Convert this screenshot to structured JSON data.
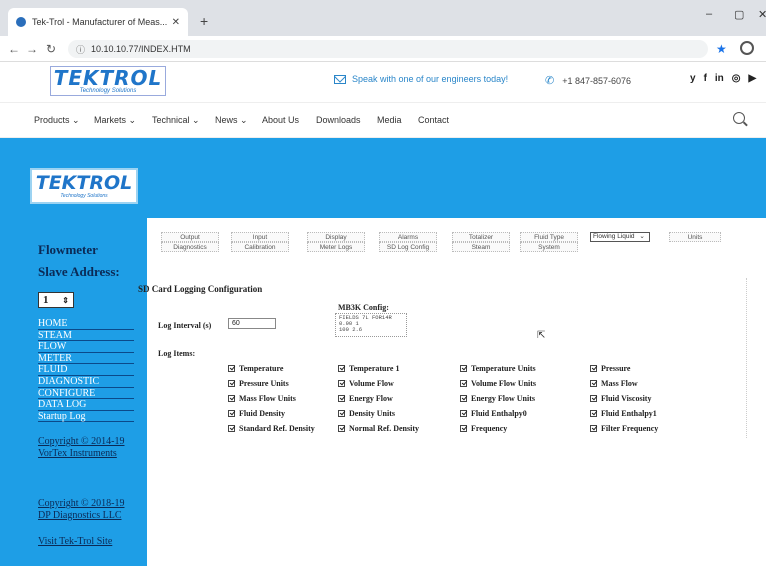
{
  "browser": {
    "tab_title": "Tek-Trol - Manufacturer of Meas...",
    "new_tab": "+",
    "url": "10.10.10.77/INDEX.HTM"
  },
  "site": {
    "logo_word": "TEKTROL",
    "logo_sub": "Technology Solutions",
    "speak_text": "Speak with one of our engineers today!",
    "phone": "+1 847-857-6076",
    "social": [
      "y",
      "f",
      "in",
      "◎",
      "▶"
    ],
    "nav": [
      "Products ⌄",
      "Markets ⌄",
      "Technical ⌄",
      "News ⌄",
      "About Us",
      "Downloads",
      "Media",
      "Contact"
    ]
  },
  "device": {
    "logo_word": "TEKTROL",
    "logo_sub": "Technology Solutions",
    "sidebar_title": "Flowmeter",
    "slave_label": "Slave Address:",
    "slave_value": "1",
    "menu": [
      "HOME",
      "STEAM",
      "FLOW",
      "METER",
      "FLUID",
      "DIAGNOSTIC",
      "CONFIGURE",
      "DATA LOG",
      "Startup Log"
    ],
    "copyright1": "Copyright © 2014-19",
    "copyright1_org": "VorTex Instruments",
    "copyright2": "Copyright © 2018-19",
    "copyright2_org": "DP Diagnostics LLC",
    "visit": "Visit Tek-Trol Site",
    "tabs_row1": [
      "Output",
      "Input",
      "Display",
      "Alarms",
      "Totalizer",
      "Fluid Type"
    ],
    "tabs_row2": [
      "Diagnostics",
      "Calibration",
      "Meter Logs",
      "SD Log Config",
      "Steam",
      "System"
    ],
    "fluid_select": "Flowing Liquid",
    "units_tab": "Units",
    "section_title": "SD Card Logging Configuration",
    "mbk_label": "MB3K Config:",
    "mbk_lines": "FIELDS 7L FOR14R\n0.90 1\n100 2.6",
    "log_interval_label": "Log Interval (s)",
    "log_interval_value": "60",
    "log_items_label": "Log Items:",
    "log_items": [
      [
        "Temperature",
        "Temperature 1",
        "Temperature Units",
        "Pressure"
      ],
      [
        "Pressure Units",
        "Volume Flow",
        "Volume Flow Units",
        "Mass Flow"
      ],
      [
        "Mass Flow Units",
        "Energy Flow",
        "Energy Flow Units",
        "Fluid Viscosity"
      ],
      [
        "Fluid Density",
        "Density Units",
        "Fluid Enthalpy0",
        "Fluid Enthalpy1"
      ],
      [
        "Standard Ref. Density",
        "Normal Ref. Density",
        "Frequency",
        "Filter Frequency"
      ]
    ]
  }
}
